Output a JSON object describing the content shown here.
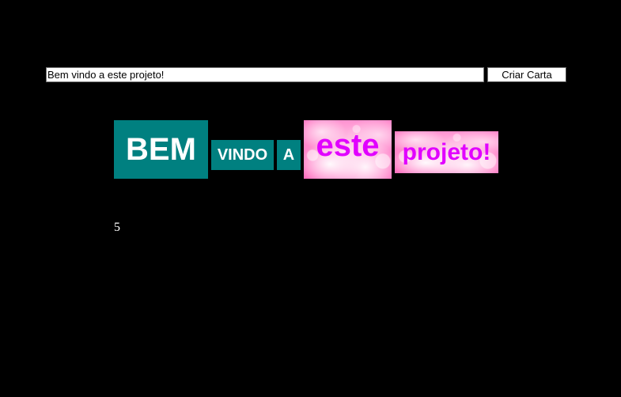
{
  "form": {
    "input_value": "Bem vindo a este projeto!",
    "button_label": "Criar Carta"
  },
  "cards": [
    {
      "text": "BEM",
      "style": "teal"
    },
    {
      "text": "VINDO",
      "style": "teal"
    },
    {
      "text": "A",
      "style": "teal"
    },
    {
      "text": "este",
      "style": "pink"
    },
    {
      "text": "projeto!",
      "style": "pink"
    }
  ],
  "card_count": "5",
  "colors": {
    "background": "#000000",
    "teal_card": "#008080",
    "teal_text": "#ffffff",
    "pink_text": "#e100ff"
  }
}
